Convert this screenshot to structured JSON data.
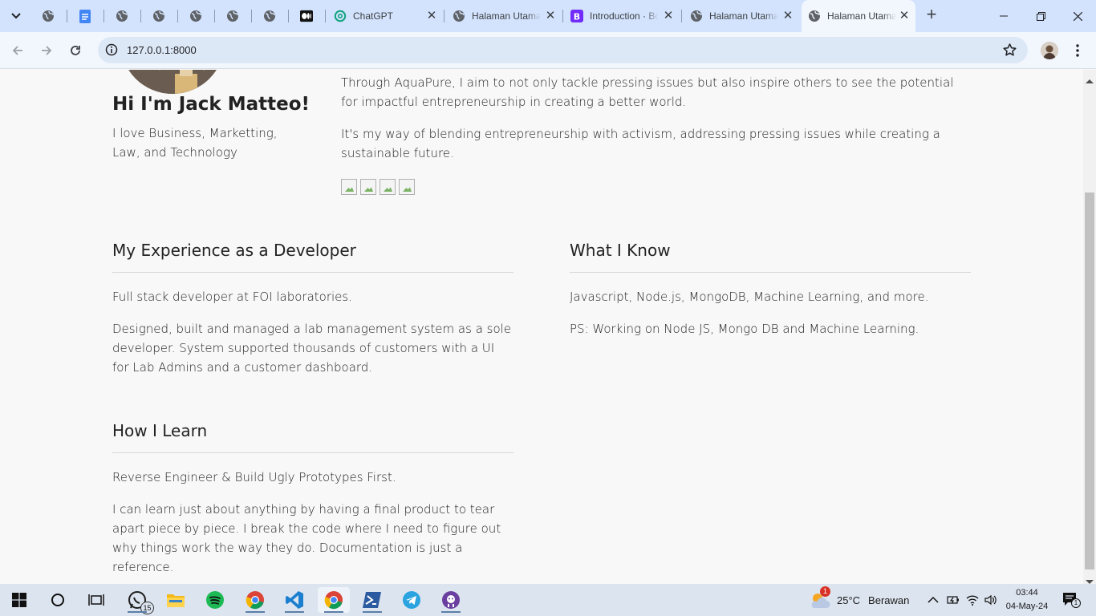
{
  "browser": {
    "tabs": [
      {
        "title": "ChatGPT",
        "icon": "chatgpt-icon"
      },
      {
        "title": "Halaman Utama",
        "icon": "globe-icon"
      },
      {
        "title": "Introduction · Bootstrap",
        "icon": "bootstrap-icon"
      },
      {
        "title": "Halaman Utama",
        "icon": "globe-icon"
      },
      {
        "title": "Halaman Utama",
        "icon": "globe-icon",
        "active": true
      }
    ],
    "pinned_icons": [
      "globe-icon",
      "google-docs-icon",
      "globe-icon",
      "globe-icon",
      "globe-icon",
      "globe-icon",
      "globe-icon",
      "medium-icon"
    ],
    "url": "127.0.0.1:8000",
    "close_glyph": "✕",
    "new_tab_glyph": "+"
  },
  "profile": {
    "name": "Hi I'm Jack Matteo!",
    "tagline": "I love Business, Marketting, Law, and Technology"
  },
  "bio": {
    "p1": "Through AquaPure, I aim to not only tackle pressing issues but also inspire others to see the potential for impactful entrepreneurship in creating a better world.",
    "p2": "It's my way of blending entrepreneurship with activism, addressing pressing issues while creating a sustainable future."
  },
  "experience": {
    "title": "My Experience as a Developer",
    "p1": "Full stack developer at FOI laboratories.",
    "p2": "Designed, built and managed a lab management system as a sole developer. System supported thousands of customers with a UI for Lab Admins and a customer dashboard."
  },
  "know": {
    "title": "What I Know",
    "p1": "Javascript, Node.js, MongoDB, Machine Learning, and more.",
    "p2": "PS: Working on Node JS, Mongo DB and Machine Learning."
  },
  "learn": {
    "title": "How I Learn",
    "p1": "Reverse Engineer & Build Ugly Prototypes First.",
    "p2": "I can learn just about anything by having a final product to tear apart piece by piece. I break the code where I need to figure out why things work the way they do. Documentation is just a reference."
  },
  "taskbar": {
    "whatsapp_badge": "15",
    "weather_badge": "1",
    "temperature": "25°C",
    "weather": "Berawan",
    "time": "03:44",
    "date": "04-May-24",
    "notification_badge": "1"
  },
  "colors": {
    "tabstrip": "#d3e3fd",
    "toolbar": "#f2f7fe",
    "omnibox": "#dde8f7",
    "page": "#f8f8f8",
    "taskbar": "#dce4ef"
  }
}
